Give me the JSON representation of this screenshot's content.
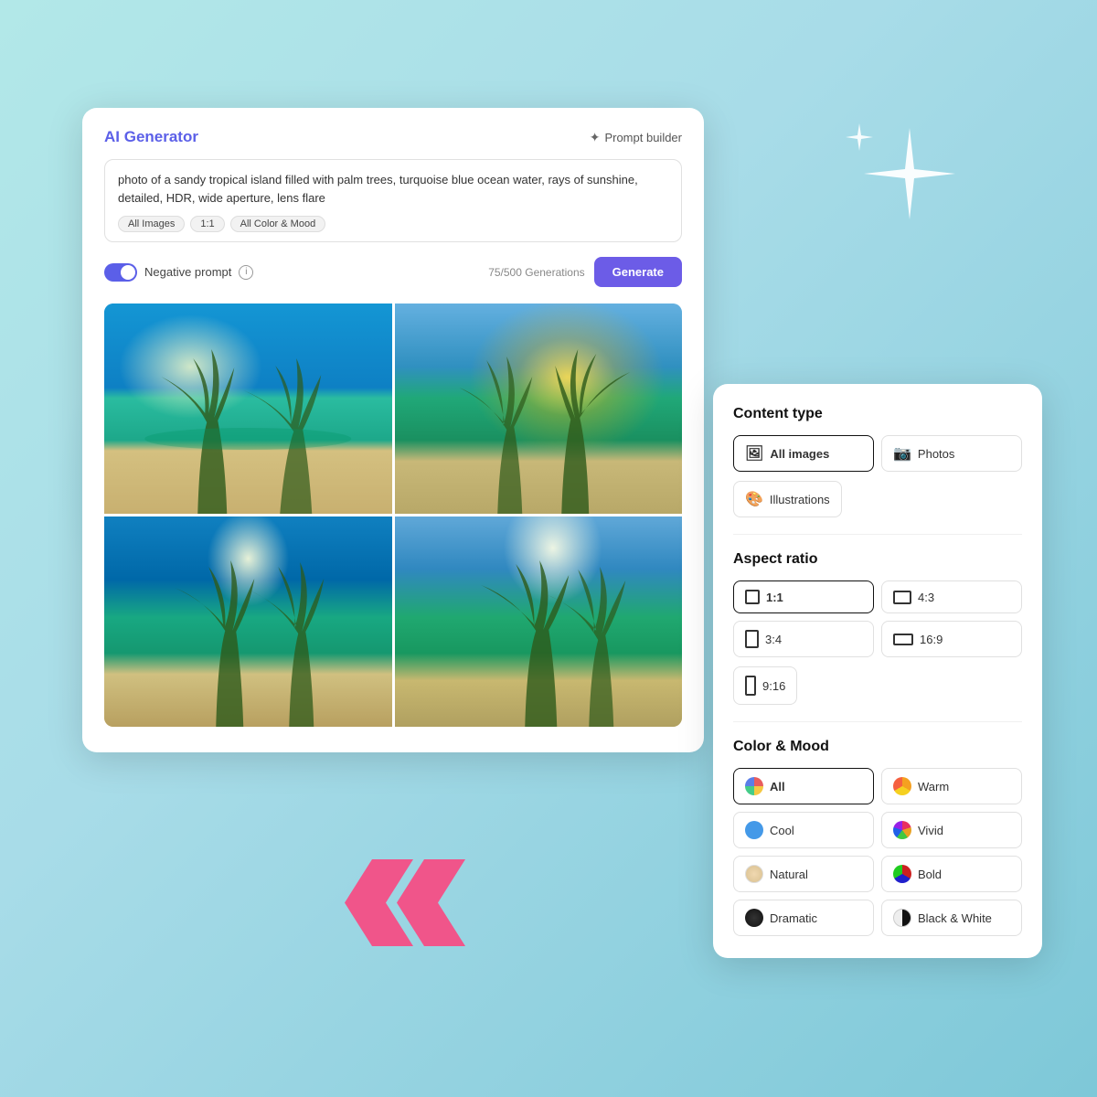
{
  "background": {
    "gradient_start": "#b2e8e8",
    "gradient_end": "#7ec8d8"
  },
  "ai_card": {
    "title": "AI Generator",
    "prompt_builder_label": "Prompt builder",
    "prompt_text": "photo of a sandy tropical island filled with palm trees, turquoise blue ocean water, rays of sunshine, detailed, HDR, wide aperture, lens flare",
    "tags": [
      "All Images",
      "1:1",
      "All Color & Mood"
    ],
    "negative_prompt_label": "Negative prompt",
    "generation_count": "75/500 Generations",
    "generate_label": "Generate"
  },
  "filter_card": {
    "content_type_title": "Content type",
    "content_options": [
      {
        "label": "All images",
        "active": true
      },
      {
        "label": "Photos",
        "active": false
      },
      {
        "label": "Illustrations",
        "active": false
      }
    ],
    "aspect_ratio_title": "Aspect ratio",
    "aspect_options": [
      {
        "label": "1:1",
        "ratio": "1-1",
        "active": true
      },
      {
        "label": "4:3",
        "ratio": "4-3",
        "active": false
      },
      {
        "label": "3:4",
        "ratio": "3-4",
        "active": false
      },
      {
        "label": "16:9",
        "ratio": "16-9",
        "active": false
      },
      {
        "label": "9:16",
        "ratio": "9-16",
        "active": false
      }
    ],
    "color_mood_title": "Color & Mood",
    "mood_options": [
      {
        "label": "All",
        "mood": "all",
        "active": true
      },
      {
        "label": "Warm",
        "mood": "warm",
        "active": false
      },
      {
        "label": "Cool",
        "mood": "cool",
        "active": false
      },
      {
        "label": "Vivid",
        "mood": "vivid",
        "active": false
      },
      {
        "label": "Natural",
        "mood": "natural",
        "active": false
      },
      {
        "label": "Bold",
        "mood": "bold",
        "active": false
      },
      {
        "label": "Dramatic",
        "mood": "dramatic",
        "active": false
      },
      {
        "label": "Black & White",
        "mood": "bw",
        "active": false
      }
    ]
  },
  "icons": {
    "prompt_builder": "✦",
    "all_images_icon": "🖼",
    "photos_icon": "📷",
    "illustrations_icon": "🎨",
    "info": "i"
  }
}
